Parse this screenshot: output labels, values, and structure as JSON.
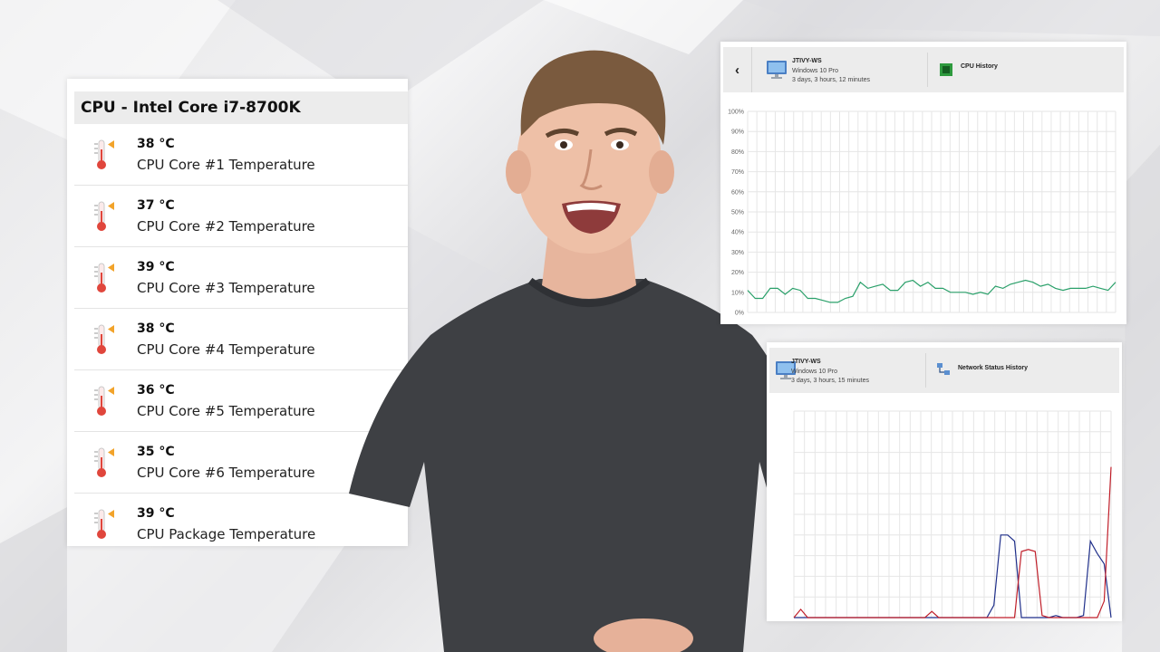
{
  "temp_panel": {
    "title": "CPU - Intel Core i7-8700K",
    "sensors": [
      {
        "value": "38 °C",
        "label": "CPU Core #1 Temperature"
      },
      {
        "value": "37 °C",
        "label": "CPU Core #2 Temperature"
      },
      {
        "value": "39 °C",
        "label": "CPU Core #3 Temperature"
      },
      {
        "value": "38 °C",
        "label": "CPU Core #4 Temperature"
      },
      {
        "value": "36 °C",
        "label": "CPU Core #5 Temperature"
      },
      {
        "value": "35 °C",
        "label": "CPU Core #6 Temperature"
      },
      {
        "value": "39 °C",
        "label": "CPU Package Temperature"
      }
    ]
  },
  "cpu_panel": {
    "back_icon": "chevron-left-icon",
    "host": "JTIVY-WS",
    "os": "Windows 10 Pro",
    "uptime": "3 days, 3 hours, 12 minutes",
    "history_title": "CPU History",
    "history_icon": "cpu-chip-icon"
  },
  "net_panel": {
    "host": "JTIVY-WS",
    "os": "Windows 10 Pro",
    "uptime": "3 days, 3 hours, 15 minutes",
    "history_title": "Network Status History",
    "history_icon": "network-icon"
  },
  "colors": {
    "cpu_line": "#2aa06a",
    "net_blue": "#1f2f8a",
    "net_red": "#c01f2a",
    "grid": "#e6e6e6"
  },
  "chart_data": [
    {
      "type": "line",
      "title": "CPU History",
      "y_tick_labels": [
        "100%",
        "90%",
        "80%",
        "70%",
        "60%",
        "50%",
        "40%",
        "30%",
        "20%",
        "10%",
        "0%"
      ],
      "ylim": [
        0,
        100
      ],
      "grid": true,
      "series": [
        {
          "values": [
            11,
            7,
            7,
            12,
            12,
            9,
            12,
            11,
            7,
            7,
            6,
            5,
            5,
            7,
            8,
            15,
            12,
            13,
            14,
            11,
            11,
            15,
            16,
            13,
            15,
            12,
            12,
            10,
            10,
            10,
            9,
            10,
            9,
            13,
            12,
            14,
            15,
            16,
            15,
            13,
            14,
            12,
            11,
            12,
            12,
            12,
            13,
            12,
            11,
            15
          ]
        }
      ]
    },
    {
      "type": "line",
      "title": "Network Status History",
      "ylim": [
        0,
        100
      ],
      "grid": true,
      "series": [
        {
          "values": [
            0,
            0,
            0,
            0,
            0,
            0,
            0,
            0,
            0,
            0,
            0,
            0,
            0,
            0,
            0,
            0,
            0,
            0,
            0,
            0,
            0,
            0,
            0,
            0,
            0,
            0,
            0,
            0,
            0,
            6,
            40,
            40,
            37,
            0,
            0,
            0,
            0,
            0,
            1,
            0,
            0,
            0,
            1,
            37,
            31,
            26,
            0
          ]
        },
        {
          "values": [
            0,
            4,
            0,
            0,
            0,
            0,
            0,
            0,
            0,
            0,
            0,
            0,
            0,
            0,
            0,
            0,
            0,
            0,
            0,
            0,
            3,
            0,
            0,
            0,
            0,
            0,
            0,
            0,
            0,
            0,
            0,
            0,
            0,
            32,
            33,
            32,
            1,
            0,
            0,
            0,
            0,
            0,
            0,
            0,
            0,
            8,
            73
          ]
        }
      ]
    }
  ]
}
